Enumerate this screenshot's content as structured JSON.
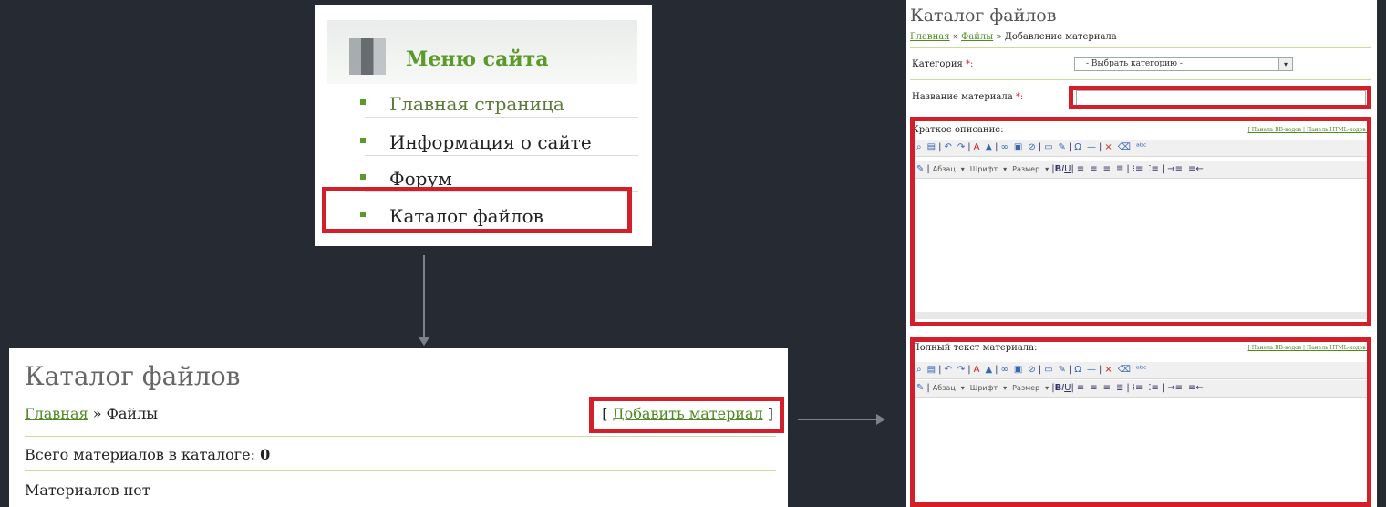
{
  "menu": {
    "title": "Меню сайта",
    "items": [
      {
        "label": "Главная страница"
      },
      {
        "label": "Информация о сайте"
      },
      {
        "label": "Форум"
      },
      {
        "label": "Каталог файлов"
      }
    ]
  },
  "catalog": {
    "title": "Каталог файлов",
    "breadcrumb_home": "Главная",
    "breadcrumb_sep": " » ",
    "breadcrumb_current": "Файлы",
    "add_open": "[ ",
    "add_link": "Добавить материал",
    "add_close": " ]",
    "total_label": "Всего материалов в каталоге: ",
    "total_value": "0",
    "empty_text": "Материалов нет"
  },
  "add_form": {
    "title": "Каталог файлов",
    "breadcrumb_home": "Главная",
    "breadcrumb_sep1": " » ",
    "breadcrumb_files": "Файлы",
    "breadcrumb_sep2": " » ",
    "breadcrumb_current": "Добавление материала",
    "category_label": "Категория",
    "category_select": "- Выбрать категорию -",
    "name_label": "Название материала",
    "required_mark": " *:",
    "short_desc_label": "Краткое описание:",
    "full_text_label": "Полный текст материала:",
    "panel_switch": "[ Панель BB-кодов | Панель HTML-кодов ]",
    "toolbar_paragraph": "Абзац",
    "toolbar_font": "Шрифт",
    "toolbar_size": "Размер"
  },
  "colors": {
    "highlight": "#d31f2a",
    "green": "#5b9a2a",
    "background": "#262b33"
  }
}
